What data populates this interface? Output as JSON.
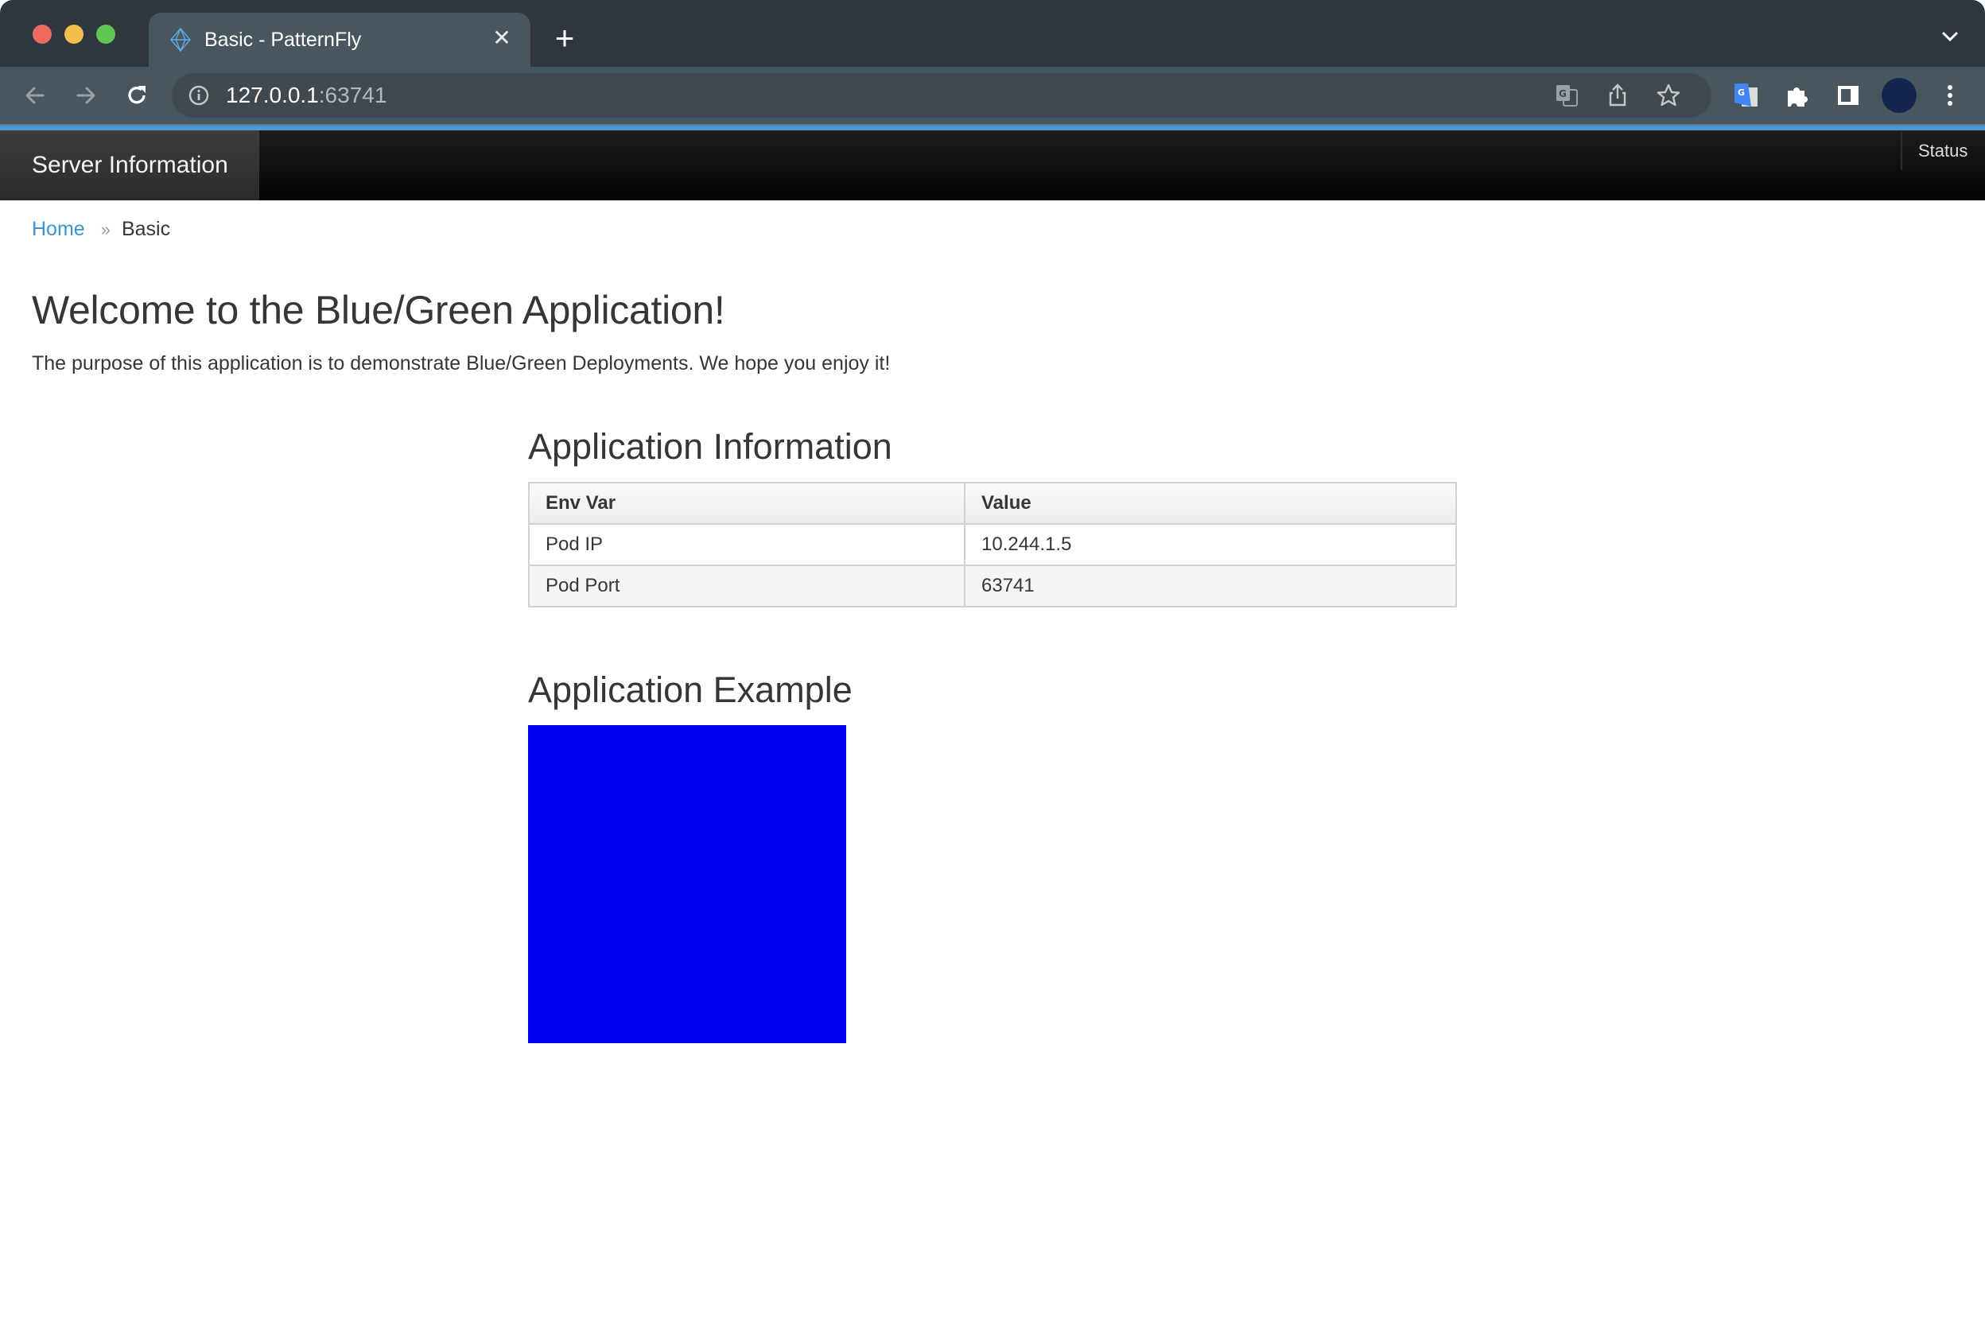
{
  "browser": {
    "tab_title": "Basic - PatternFly",
    "tab_icon": "patternfly-logo-icon",
    "url_host": "127.0.0.1",
    "url_port": ":63741",
    "colors": {
      "tabbar_bg": "#2f363d",
      "toolbar_bg": "#48565f",
      "accent": "#4a9ad8",
      "profile_avatar": "#12254f"
    },
    "toolbar_icons": [
      "back-arrow-icon",
      "forward-arrow-icon",
      "reload-icon",
      "info-icon",
      "translate-icon",
      "share-icon",
      "bookmark-star-icon",
      "google-translate-extension-icon",
      "extensions-puzzle-icon",
      "side-panel-icon",
      "profile-avatar",
      "kebab-menu-icon"
    ]
  },
  "nav": {
    "brand": "Server Information",
    "status": "Status"
  },
  "breadcrumb": {
    "home": "Home",
    "separator": "»",
    "current": "Basic"
  },
  "page": {
    "title": "Welcome to the Blue/Green Application!",
    "lead": "The purpose of this application is to demonstrate Blue/Green Deployments. We hope you enjoy it!"
  },
  "app_info": {
    "title": "Application Information",
    "columns": [
      "Env Var",
      "Value"
    ],
    "rows": [
      [
        "Pod IP",
        "10.244.1.5"
      ],
      [
        "Pod Port",
        "63741"
      ]
    ]
  },
  "app_example": {
    "title": "Application Example",
    "color": "#0000f0",
    "color_name": "blue"
  }
}
